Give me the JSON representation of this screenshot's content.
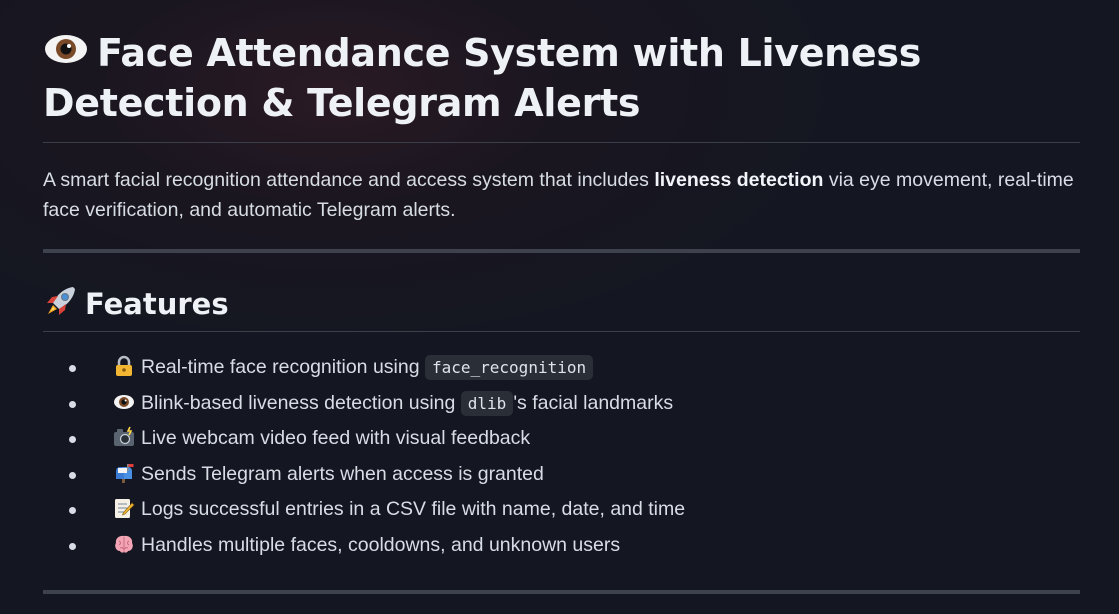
{
  "title": {
    "icon": "eye-icon",
    "text": "Face Attendance System with Liveness Detection & Telegram Alerts"
  },
  "intro": {
    "before": "A smart facial recognition attendance and access system that includes ",
    "bold": "liveness detection",
    "after": " via eye movement, real-time face verification, and automatic Telegram alerts."
  },
  "features": {
    "icon": "rocket-icon",
    "heading": "Features",
    "items": [
      {
        "icon": "lock-icon",
        "before": "Real-time face recognition using ",
        "code": "face_recognition",
        "after": ""
      },
      {
        "icon": "eye-icon",
        "before": "Blink-based liveness detection using ",
        "code": "dlib",
        "after": "'s facial landmarks"
      },
      {
        "icon": "camera-flash-icon",
        "before": "Live webcam video feed with visual feedback",
        "code": "",
        "after": ""
      },
      {
        "icon": "mailbox-icon",
        "before": "Sends Telegram alerts when access is granted",
        "code": "",
        "after": ""
      },
      {
        "icon": "memo-icon",
        "before": "Logs successful entries in a CSV file with name, date, and time",
        "code": "",
        "after": ""
      },
      {
        "icon": "brain-icon",
        "before": "Handles multiple faces, cooldowns, and unknown users",
        "code": "",
        "after": ""
      }
    ]
  },
  "colors": {
    "background": "#141721",
    "text": "#d8dde5",
    "heading": "#eef1f5",
    "rule": "#3d424c",
    "code_bg": "#2a2e37"
  }
}
